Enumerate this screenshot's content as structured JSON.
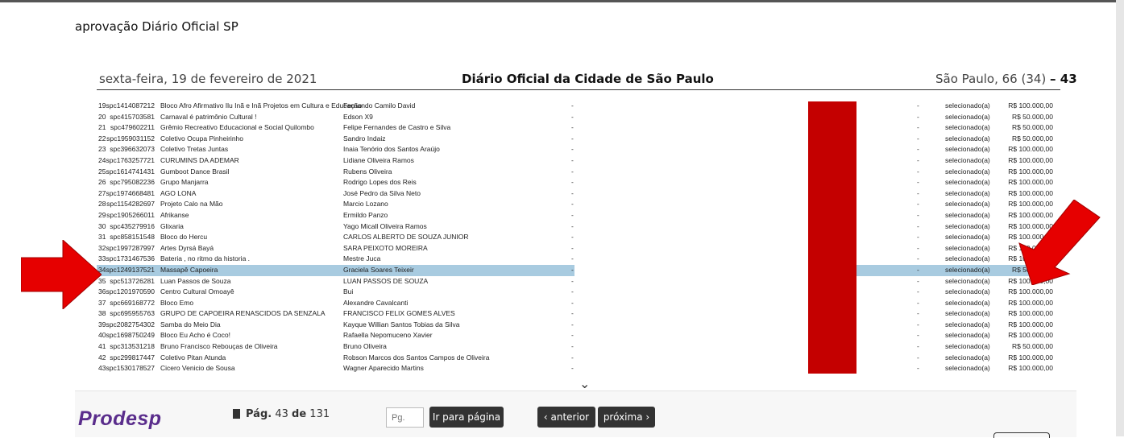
{
  "caption": "aprovação Diário Oficial SP",
  "header": {
    "date": "sexta-feira, 19 de fevereiro de 2021",
    "title": "Diário Oficial da Cidade de São Paulo",
    "edition": "São Paulo, 66 (34)",
    "page": "– 43"
  },
  "rows": [
    {
      "num": "19",
      "code": "spc1414087212",
      "name": "Bloco Afro Afirmativo Ilu Inã e Inã Projetos em Cultura e Educação",
      "resp": "Fernando Camilo David",
      "d1": "-",
      "d2": "-",
      "status": "selecionado(a)",
      "value": "R$ 100.000,00"
    },
    {
      "num": "20",
      "code": "spc415703581",
      "name": "Carnaval é patrimônio Cultural !",
      "resp": "Edson X9",
      "d1": "-",
      "d2": "-",
      "status": "selecionado(a)",
      "value": "R$ 50.000,00"
    },
    {
      "num": "21",
      "code": "spc479602211",
      "name": "Grêmio Recreativo Educacional e Social Quilombo",
      "resp": "Felipe Fernandes de Castro e Silva",
      "d1": "-",
      "d2": "-",
      "status": "selecionado(a)",
      "value": "R$ 50.000,00"
    },
    {
      "num": "22",
      "code": "spc1959031152",
      "name": "Coletivo Ocupa Pinheirinho",
      "resp": "Sandro Indaiz",
      "d1": "-",
      "d2": "-",
      "status": "selecionado(a)",
      "value": "R$ 50.000,00"
    },
    {
      "num": "23",
      "code": "spc396632073",
      "name": "Coletivo Tretas Juntas",
      "resp": "Inaia Tenório dos Santos Araújo",
      "d1": "-",
      "d2": "-",
      "status": "selecionado(a)",
      "value": "R$ 100.000,00"
    },
    {
      "num": "24",
      "code": "spc1763257721",
      "name": "CURUMINS DA ADEMAR",
      "resp": "Lidiane Oliveira Ramos",
      "d1": "-",
      "d2": "-",
      "status": "selecionado(a)",
      "value": "R$ 100.000,00"
    },
    {
      "num": "25",
      "code": "spc1614741431",
      "name": "Gumboot Dance Brasil",
      "resp": "Rubens Oliveira",
      "d1": "-",
      "d2": "-",
      "status": "selecionado(a)",
      "value": "R$ 100.000,00"
    },
    {
      "num": "26",
      "code": "spc795082236",
      "name": "Grupo Manjarra",
      "resp": "Rodrigo Lopes dos Reis",
      "d1": "-",
      "d2": "-",
      "status": "selecionado(a)",
      "value": "R$ 100.000,00"
    },
    {
      "num": "27",
      "code": "spc1974668481",
      "name": "AGO LONA",
      "resp": "José Pedro da Silva Neto",
      "d1": "-",
      "d2": "-",
      "status": "selecionado(a)",
      "value": "R$ 100.000,00"
    },
    {
      "num": "28",
      "code": "spc1154282697",
      "name": "Projeto Calo na Mão",
      "resp": "Marcio Lozano",
      "d1": "-",
      "d2": "-",
      "status": "selecionado(a)",
      "value": "R$ 100.000,00"
    },
    {
      "num": "29",
      "code": "spc1905266011",
      "name": "Afrikanse",
      "resp": "Ermildo Panzo",
      "d1": "-",
      "d2": "-",
      "status": "selecionado(a)",
      "value": "R$ 100.000,00"
    },
    {
      "num": "30",
      "code": "spc435279916",
      "name": "Glixaria",
      "resp": "Yago Micall Oliveira Ramos",
      "d1": "-",
      "d2": "-",
      "status": "selecionado(a)",
      "value": "R$ 100.000,00"
    },
    {
      "num": "31",
      "code": "spc858151548",
      "name": "Bloco do Hercu",
      "resp": "CARLOS ALBERTO DE SOUZA JUNIOR",
      "d1": "-",
      "d2": "-",
      "status": "selecionado(a)",
      "value": "R$ 100.000,00"
    },
    {
      "num": "32",
      "code": "spc1997287997",
      "name": "Artes Dyrsá Bayá",
      "resp": "SARA PEIXOTO MOREIRA",
      "d1": "-",
      "d2": "-",
      "status": "selecionado(a)",
      "value": "R$ 100.000,00"
    },
    {
      "num": "33",
      "code": "spc1731467536",
      "name": "Bateria , no ritmo da historia .",
      "resp": "Mestre Juca",
      "d1": "-",
      "d2": "-",
      "status": "selecionado(a)",
      "value": "R$ 100.000,00"
    },
    {
      "num": "34",
      "code": "spc1249137521",
      "name": "Massapê Capoeira",
      "resp": "Graciela Soares Teixeir",
      "d1": "-",
      "d2": "-",
      "status": "selecionado(a)",
      "value": "R$ 50.000,00"
    },
    {
      "num": "35",
      "code": "spc513726281",
      "name": "Luan Passos de Souza",
      "resp": "LUAN PASSOS DE SOUZA",
      "d1": "-",
      "d2": "-",
      "status": "selecionado(a)",
      "value": "R$ 100.000,00"
    },
    {
      "num": "36",
      "code": "spc1201970590",
      "name": "Centro Cultural Omoayê",
      "resp": "Bui",
      "d1": "-",
      "d2": "-",
      "status": "selecionado(a)",
      "value": "R$ 100.000,00"
    },
    {
      "num": "37",
      "code": "spc669168772",
      "name": "Bloco Emo",
      "resp": "Alexandre Cavalcanti",
      "d1": "-",
      "d2": "-",
      "status": "selecionado(a)",
      "value": "R$ 100.000,00"
    },
    {
      "num": "38",
      "code": "spc695955763",
      "name": "GRUPO DE CAPOEIRA RENASCIDOS DA SENZALA",
      "resp": "FRANCISCO FELIX GOMES ALVES",
      "d1": "-",
      "d2": "-",
      "status": "selecionado(a)",
      "value": "R$ 100.000,00"
    },
    {
      "num": "39",
      "code": "spc2082754302",
      "name": "Samba do Meio Dia",
      "resp": "Kayque Willian Santos Tobias da Silva",
      "d1": "-",
      "d2": "-",
      "status": "selecionado(a)",
      "value": "R$ 100.000,00"
    },
    {
      "num": "40",
      "code": "spc1698750249",
      "name": "Bloco Eu Acho é Coco!",
      "resp": "Rafaella Nepomuceno Xavier",
      "d1": "-",
      "d2": "-",
      "status": "selecionado(a)",
      "value": "R$ 100.000,00"
    },
    {
      "num": "41",
      "code": "spc313531218",
      "name": "Bruno Francisco Rebouças de Oliveira",
      "resp": "Bruno Oliveira",
      "d1": "-",
      "d2": "-",
      "status": "selecionado(a)",
      "value": "R$ 50.000,00"
    },
    {
      "num": "42",
      "code": "spc299817447",
      "name": "Coletivo Pitan Atunda",
      "resp": "Robson Marcos dos Santos Campos de Oliveira",
      "d1": "-",
      "d2": "-",
      "status": "selecionado(a)",
      "value": "R$ 100.000,00"
    },
    {
      "num": "43",
      "code": "spc1530178527",
      "name": "Cicero Venicio de Sousa",
      "resp": "Wagner Aparecido Martins",
      "d1": "-",
      "d2": "-",
      "status": "selecionado(a)",
      "value": "R$ 100.000,00"
    }
  ],
  "highlighted_row": "34",
  "footer": {
    "logo": "Prodesp",
    "page_label": "Pág.",
    "page_current": "43",
    "page_of": "de",
    "page_total": "131",
    "page_input_placeholder": "Pg.",
    "go_button": "Ir para página",
    "prev_button": "‹ anterior",
    "next_button": "próxima ›"
  },
  "colors": {
    "highlight": "#a8cbe0",
    "redaction": "#c40000",
    "arrow": "#e60000",
    "logo": "#5a2d8c"
  }
}
